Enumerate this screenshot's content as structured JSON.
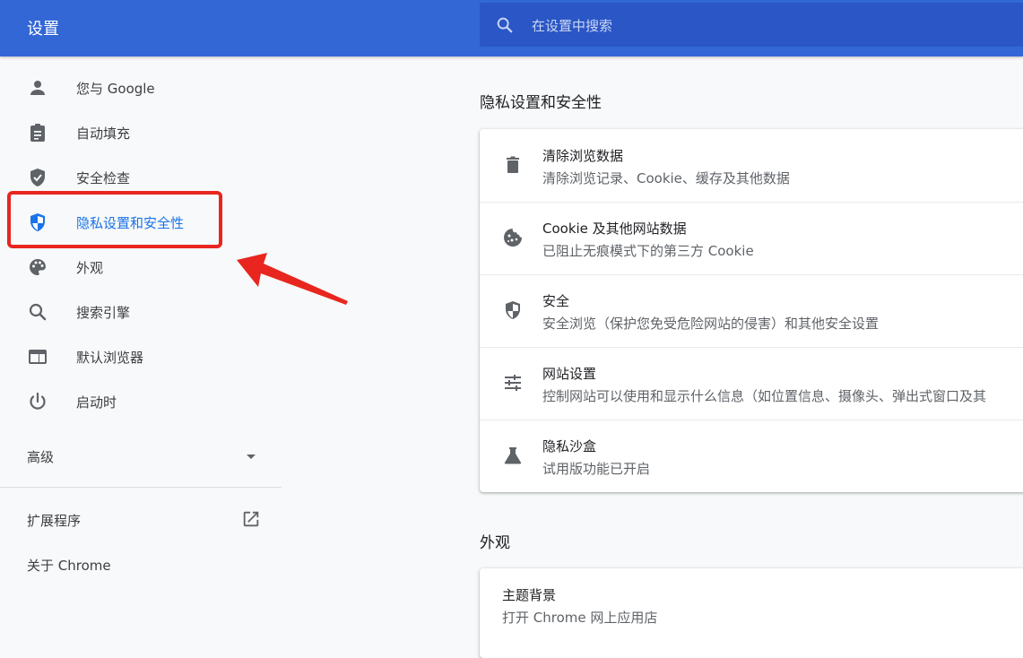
{
  "header": {
    "title": "设置"
  },
  "search": {
    "placeholder": "在设置中搜索"
  },
  "sidebar": {
    "items": [
      {
        "label": "您与 Google",
        "icon": "person-icon"
      },
      {
        "label": "自动填充",
        "icon": "clipboard-icon"
      },
      {
        "label": "安全检查",
        "icon": "shield-check-icon"
      },
      {
        "label": "隐私设置和安全性",
        "icon": "shield-privacy-icon",
        "active": true
      },
      {
        "label": "外观",
        "icon": "palette-icon"
      },
      {
        "label": "搜索引擎",
        "icon": "search-icon"
      },
      {
        "label": "默认浏览器",
        "icon": "browser-window-icon"
      },
      {
        "label": "启动时",
        "icon": "power-icon"
      }
    ],
    "advanced": {
      "label": "高级"
    },
    "extensions": {
      "label": "扩展程序"
    },
    "about": {
      "label": "关于 Chrome"
    }
  },
  "privacy": {
    "title": "隐私设置和安全性",
    "rows": [
      {
        "title": "清除浏览数据",
        "sub": "清除浏览记录、Cookie、缓存及其他数据",
        "icon": "trash-icon"
      },
      {
        "title": "Cookie 及其他网站数据",
        "sub": "已阻止无痕模式下的第三方 Cookie",
        "icon": "cookie-icon"
      },
      {
        "title": "安全",
        "sub": "安全浏览（保护您免受危险网站的侵害）和其他安全设置",
        "icon": "shield-icon"
      },
      {
        "title": "网站设置",
        "sub": "控制网站可以使用和显示什么信息（如位置信息、摄像头、弹出式窗口及其",
        "icon": "tune-icon"
      },
      {
        "title": "隐私沙盒",
        "sub": "试用版功能已开启",
        "icon": "flask-icon"
      }
    ]
  },
  "appearance": {
    "title": "外观",
    "rows": [
      {
        "title": "主题背景",
        "sub": "打开 Chrome 网上应用店"
      }
    ]
  },
  "colors": {
    "header": "#3367d6",
    "accent": "#1a73e8",
    "annotation": "#e8261f"
  }
}
